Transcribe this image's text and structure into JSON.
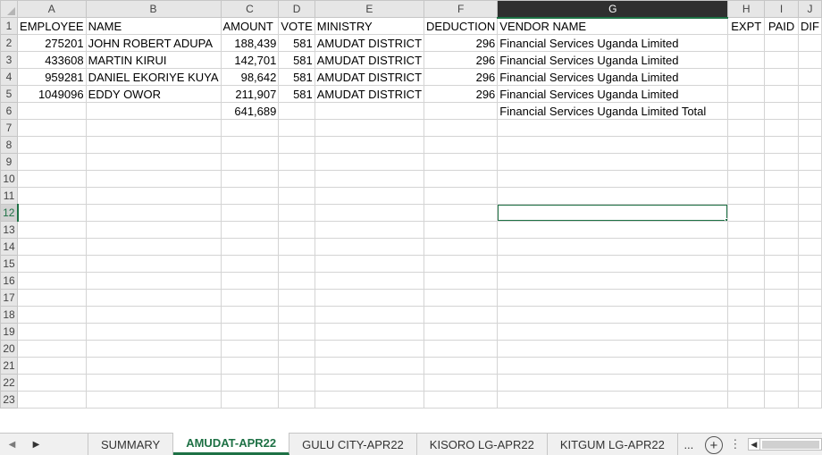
{
  "columns": [
    "A",
    "B",
    "C",
    "D",
    "E",
    "F",
    "G",
    "H",
    "I",
    "J"
  ],
  "rows": [
    {
      "n": "1",
      "cells": [
        "EMPLOYEE",
        "NAME",
        "AMOUNT",
        "VOTE",
        "MINISTRY",
        "DEDUCTION",
        "VENDOR NAME",
        "EXPT",
        "PAID",
        "DIF"
      ]
    },
    {
      "n": "2",
      "cells": [
        "275201",
        "JOHN ROBERT ADUPA",
        "188,439",
        "581",
        "AMUDAT DISTRICT",
        "296",
        "Financial Services Uganda Limited",
        "",
        "",
        ""
      ]
    },
    {
      "n": "3",
      "cells": [
        "433608",
        "MARTIN  KIRUI",
        "142,701",
        "581",
        "AMUDAT DISTRICT",
        "296",
        "Financial Services Uganda Limited",
        "",
        "",
        ""
      ]
    },
    {
      "n": "4",
      "cells": [
        "959281",
        "DANIEL EKORIYE KUYA",
        "98,642",
        "581",
        "AMUDAT DISTRICT",
        "296",
        "Financial Services Uganda Limited",
        "",
        "",
        ""
      ]
    },
    {
      "n": "5",
      "cells": [
        "1049096",
        "EDDY  OWOR",
        "211,907",
        "581",
        "AMUDAT DISTRICT",
        "296",
        "Financial Services Uganda Limited",
        "",
        "",
        ""
      ]
    },
    {
      "n": "6",
      "cells": [
        "",
        "",
        "641,689",
        "",
        "",
        "",
        "Financial Services Uganda Limited Total",
        "",
        "",
        ""
      ]
    },
    {
      "n": "7",
      "cells": [
        "",
        "",
        "",
        "",
        "",
        "",
        "",
        "",
        "",
        ""
      ]
    },
    {
      "n": "8",
      "cells": [
        "",
        "",
        "",
        "",
        "",
        "",
        "",
        "",
        "",
        ""
      ]
    },
    {
      "n": "9",
      "cells": [
        "",
        "",
        "",
        "",
        "",
        "",
        "",
        "",
        "",
        ""
      ]
    },
    {
      "n": "10",
      "cells": [
        "",
        "",
        "",
        "",
        "",
        "",
        "",
        "",
        "",
        ""
      ]
    },
    {
      "n": "11",
      "cells": [
        "",
        "",
        "",
        "",
        "",
        "",
        "",
        "",
        "",
        ""
      ]
    },
    {
      "n": "12",
      "cells": [
        "",
        "",
        "",
        "",
        "",
        "",
        "",
        "",
        "",
        ""
      ]
    },
    {
      "n": "13",
      "cells": [
        "",
        "",
        "",
        "",
        "",
        "",
        "",
        "",
        "",
        ""
      ]
    },
    {
      "n": "14",
      "cells": [
        "",
        "",
        "",
        "",
        "",
        "",
        "",
        "",
        "",
        ""
      ]
    },
    {
      "n": "15",
      "cells": [
        "",
        "",
        "",
        "",
        "",
        "",
        "",
        "",
        "",
        ""
      ]
    },
    {
      "n": "16",
      "cells": [
        "",
        "",
        "",
        "",
        "",
        "",
        "",
        "",
        "",
        ""
      ]
    },
    {
      "n": "17",
      "cells": [
        "",
        "",
        "",
        "",
        "",
        "",
        "",
        "",
        "",
        ""
      ]
    },
    {
      "n": "18",
      "cells": [
        "",
        "",
        "",
        "",
        "",
        "",
        "",
        "",
        "",
        ""
      ]
    },
    {
      "n": "19",
      "cells": [
        "",
        "",
        "",
        "",
        "",
        "",
        "",
        "",
        "",
        ""
      ]
    },
    {
      "n": "20",
      "cells": [
        "",
        "",
        "",
        "",
        "",
        "",
        "",
        "",
        "",
        ""
      ]
    },
    {
      "n": "21",
      "cells": [
        "",
        "",
        "",
        "",
        "",
        "",
        "",
        "",
        "",
        ""
      ]
    },
    {
      "n": "22",
      "cells": [
        "",
        "",
        "",
        "",
        "",
        "",
        "",
        "",
        "",
        ""
      ]
    },
    {
      "n": "23",
      "cells": [
        "",
        "",
        "",
        "",
        "",
        "",
        "",
        "",
        "",
        ""
      ]
    }
  ],
  "selection": {
    "column": "G",
    "row": "12"
  },
  "tabs": {
    "summary": "SUMMARY",
    "amudat": "AMUDAT-APR22",
    "gulu": "GULU CITY-APR22",
    "kisoro": "KISORO LG-APR22",
    "kitgum": "KITGUM LG-APR22",
    "more": "...",
    "add": "+"
  },
  "icons": {
    "prev": "chevron-left-icon",
    "next": "chevron-right-icon",
    "add": "plus-circle-icon",
    "options": "vertical-dots-icon"
  },
  "colors": {
    "accent": "#1e7145",
    "header_bg": "#e6e6e6",
    "gridline": "#d4d4d4"
  }
}
